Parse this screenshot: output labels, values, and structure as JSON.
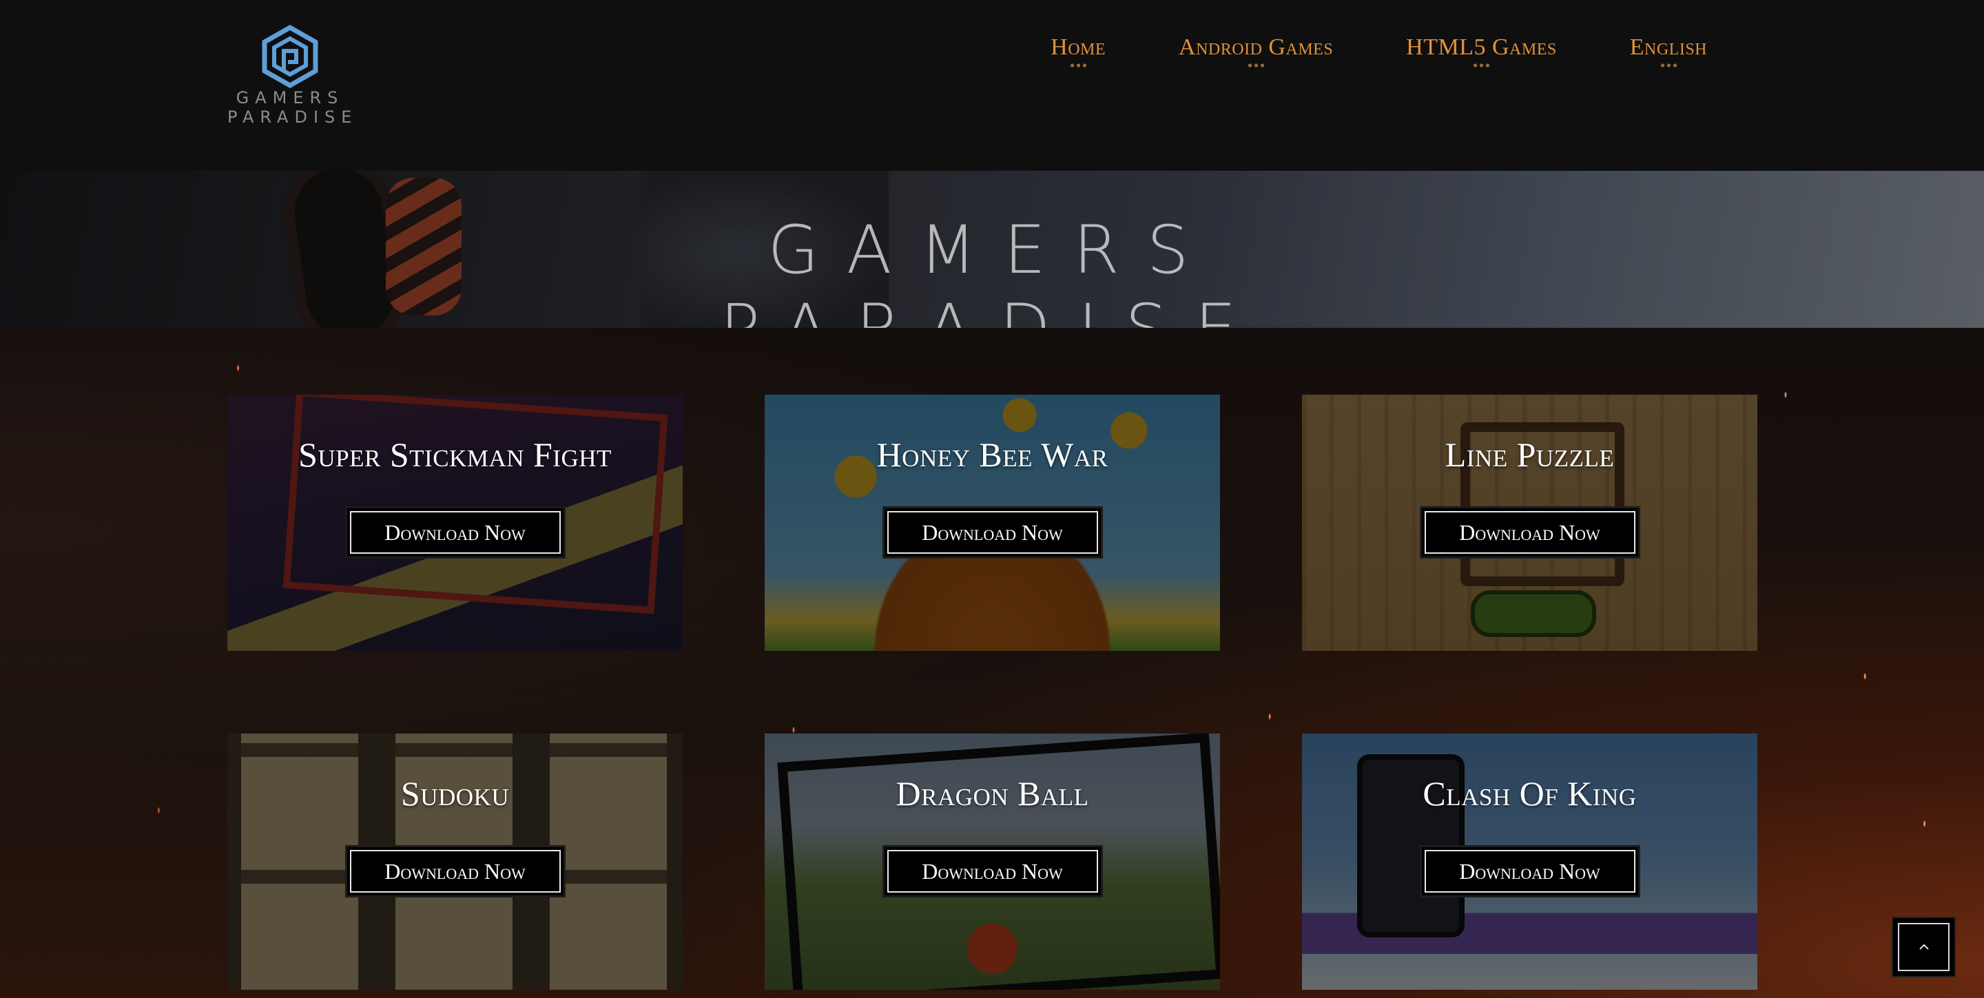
{
  "header": {
    "logo": {
      "line1": "GAMERS",
      "line2": "PARADISE",
      "icon": "hexagon-spiral-logo-icon"
    },
    "nav": [
      {
        "label": "Home"
      },
      {
        "label": "Android Games"
      },
      {
        "label": "HTML5 Games"
      },
      {
        "label": "English"
      }
    ]
  },
  "hero": {
    "line1": "GAMERS",
    "line2": "PARADISE"
  },
  "games": [
    {
      "title": "Super Stickman Fight",
      "button": "Download Now"
    },
    {
      "title": "Honey Bee War",
      "button": "Download Now"
    },
    {
      "title": "Line Puzzle",
      "button": "Download Now"
    },
    {
      "title": "Sudoku",
      "button": "Download Now"
    },
    {
      "title": "Dragon Ball",
      "button": "Download Now"
    },
    {
      "title": "Clash Of King",
      "button": "Download Now"
    }
  ],
  "colors": {
    "nav_accent": "#e3913a",
    "logo_blue": "#5f9fd8",
    "header_bg": "#0f0f0f"
  },
  "back_to_top": {
    "icon": "chevron-up-icon"
  }
}
